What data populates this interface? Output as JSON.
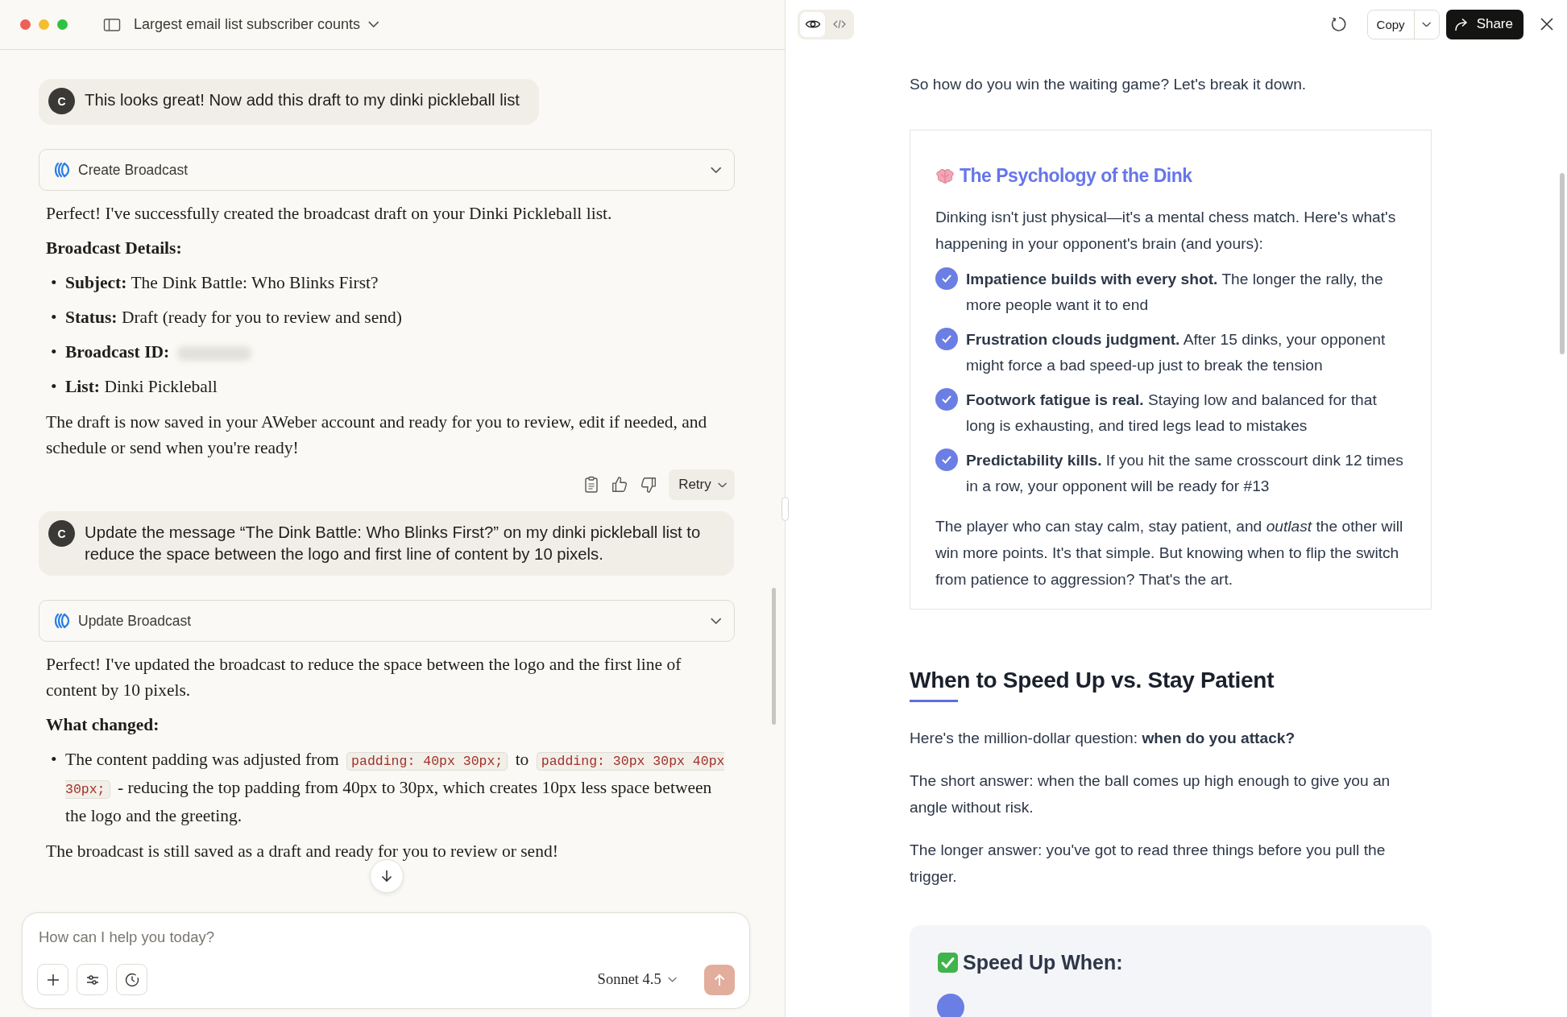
{
  "header": {
    "title": "Largest email list subscriber counts"
  },
  "conversation": [
    {
      "kind": "user",
      "avatar": "C",
      "text": "This looks great! Now add this draft to my dinki pickleball list"
    },
    {
      "kind": "tool",
      "label": "Create Broadcast",
      "expanded": false
    },
    {
      "kind": "assistant",
      "blocks": [
        {
          "kind": "paragraph",
          "text": "Perfect! I've successfully created the broadcast draft on your Dinki Pickleball list."
        },
        {
          "kind": "heading",
          "text": "Broadcast Details:"
        },
        {
          "kind": "bullets",
          "marker": "•",
          "items": [
            {
              "segments": [
                {
                  "kind": "text",
                  "text": "**Subject:** The Dink Battle: Who Blinks First?"
                }
              ]
            },
            {
              "segments": [
                {
                  "kind": "text",
                  "text": "**Status:** Draft (ready for you to review and send)"
                }
              ]
            },
            {
              "segments": [
                {
                  "kind": "text",
                  "text": "**Broadcast ID:**"
                },
                {
                  "kind": "redacted"
                }
              ]
            },
            {
              "segments": [
                {
                  "kind": "text",
                  "text": "**List:** Dinki Pickleball"
                }
              ]
            }
          ]
        },
        {
          "kind": "paragraph",
          "text": "The draft is now saved in your AWeber account and ready for you to review, edit if needed, and schedule or send when you're ready!"
        }
      ]
    },
    {
      "kind": "actions",
      "retry": "Retry"
    },
    {
      "kind": "user",
      "avatar": "C",
      "text": "Update the message “The Dink Battle: Who Blinks First?” on my dinki pickleball list to reduce the space between the logo and first line of content by 10 pixels."
    },
    {
      "kind": "tool",
      "label": "Update Broadcast",
      "expanded": false
    },
    {
      "kind": "assistant",
      "blocks": [
        {
          "kind": "paragraph",
          "text": "Perfect! I've updated the broadcast to reduce the space between the logo and the first line of content by 10 pixels."
        },
        {
          "kind": "heading",
          "text": "What changed:"
        },
        {
          "kind": "bullets",
          "marker": "•",
          "items": [
            {
              "segments": [
                {
                  "kind": "text",
                  "text": "The content padding was adjusted from"
                },
                {
                  "kind": "code",
                  "text": "padding: 40px 30px;"
                },
                {
                  "kind": "text",
                  "text": "to"
                },
                {
                  "kind": "code",
                  "text": "padding: 30px 30px 40px 30px;"
                },
                {
                  "kind": "text",
                  "text": "- reducing the top padding from 40px to 30px, which creates 10px less space between the logo and the greeting."
                }
              ]
            }
          ]
        },
        {
          "kind": "paragraph",
          "text": "The broadcast is still saved as a draft and ready for you to review or send!"
        }
      ]
    }
  ],
  "composer": {
    "placeholder": "How can I help you today?",
    "model": "Sonnet 4.5"
  },
  "preview": {
    "view_toggle": [
      {
        "kind": "preview",
        "selected": true
      },
      {
        "kind": "code",
        "selected": false
      }
    ],
    "copy": "Copy",
    "share": "Share",
    "document": [
      {
        "kind": "paragraph",
        "text": "So how do you win the waiting game? Let's break it down."
      },
      {
        "kind": "callout",
        "title": "The Psychology of the Dink",
        "intro": "Dinking isn't just physical—it's a mental chess match. Here's what's happening in your opponent's brain (and yours):",
        "points": [
          "**Impatience builds with every shot.** The longer the rally, the more people want it to end",
          "**Frustration clouds judgment.** After 15 dinks, your opponent might force a bad speed-up just to break the tension",
          "**Footwork fatigue is real.** Staying low and balanced for that long is exhausting, and tired legs lead to mistakes",
          "**Predictability kills.** If you hit the same crosscourt dink 12 times in a row, your opponent will be ready for #13"
        ],
        "outro": "The player who can stay calm, stay patient, and *outlast* the other will win more points. It's that simple. But knowing when to flip the switch from patience to aggression? That's the art."
      },
      {
        "kind": "heading",
        "text": "When to Speed Up vs. Stay Patient"
      },
      {
        "kind": "paragraph",
        "text": "Here's the million-dollar question: **when do you attack?**"
      },
      {
        "kind": "paragraph",
        "text": "The short answer: when the ball comes up high enough to give you an angle without risk."
      },
      {
        "kind": "paragraph",
        "text": "The longer answer: you've got to read three things before you pull the trigger."
      },
      {
        "kind": "checklist",
        "title": "Speed Up When:"
      }
    ]
  }
}
